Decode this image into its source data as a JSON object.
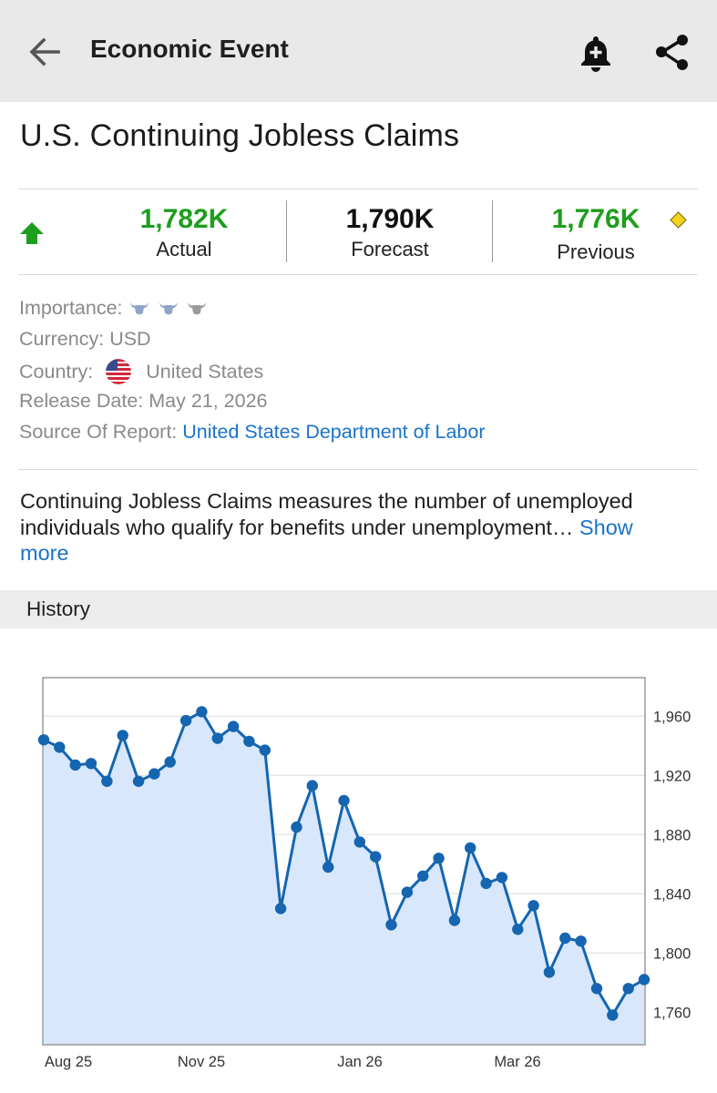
{
  "header": {
    "title": "Economic Event"
  },
  "event": {
    "title": "U.S. Continuing Jobless Claims"
  },
  "stats": {
    "actual": {
      "value": "1,782K",
      "label": "Actual"
    },
    "forecast": {
      "value": "1,790K",
      "label": "Forecast"
    },
    "previous": {
      "value": "1,776K",
      "label": "Previous"
    }
  },
  "info": {
    "importance_label": "Importance:",
    "currency_label": "Currency:",
    "currency_value": "USD",
    "country_label": "Country:",
    "country_value": "United States",
    "release_label": "Release Date:",
    "release_value": "May 21, 2026",
    "source_label": "Source Of Report:",
    "source_value": "United States Department of Labor"
  },
  "description": {
    "text": "Continuing Jobless Claims measures the number of unemployed individuals who qualify for benefits under unemployment…",
    "more": "Show more"
  },
  "history": {
    "title": "History"
  },
  "colors": {
    "positive": "#1e9e1e",
    "neutral": "#111111",
    "link": "#1a73c9",
    "line": "#1565b0",
    "area": "#d8e7fb"
  },
  "chart_data": {
    "type": "area",
    "title": "",
    "xlabel": "",
    "ylabel": "",
    "x_tick_labels": [
      "Aug 25",
      "Nov 25",
      "Jan 26",
      "Mar 26"
    ],
    "y_ticks": [
      1760,
      1800,
      1840,
      1880,
      1920,
      1960
    ],
    "y_tick_labels": [
      "1,760",
      "1,800",
      "1,840",
      "1,880",
      "1,920",
      "1,960"
    ],
    "ylim": [
      1738,
      1986
    ],
    "grid": true,
    "series": [
      {
        "values": [
          1944,
          1939,
          1927,
          1928,
          1916,
          1947,
          1916,
          1921,
          1929,
          1957,
          1963,
          1945,
          1953,
          1943,
          1937,
          1830,
          1885,
          1913,
          1858,
          1903,
          1875,
          1865,
          1819,
          1841,
          1852,
          1864,
          1822,
          1871,
          1847,
          1851,
          1816,
          1832,
          1787,
          1810,
          1808,
          1776,
          1758,
          1776,
          1782
        ]
      }
    ]
  }
}
